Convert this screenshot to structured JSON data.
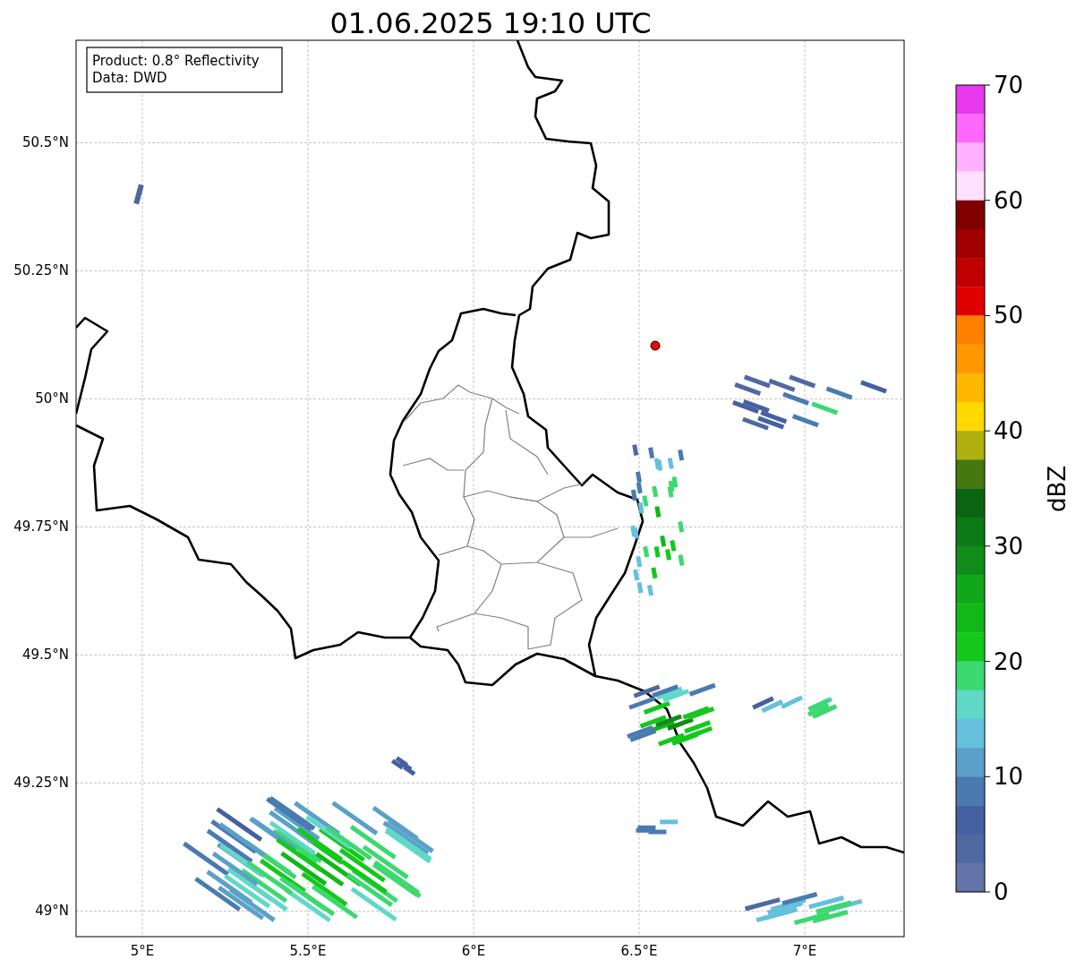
{
  "title": "01.06.2025 19:10 UTC",
  "info_box": [
    "Product: 0.8° Reflectivity",
    "Data: DWD"
  ],
  "map": {
    "lon_ticks": [
      "5°E",
      "5.5°E",
      "6°E",
      "6.5°E",
      "7°E"
    ],
    "lat_ticks": [
      "50.5°N",
      "50.25°N",
      "50°N",
      "49.75°N",
      "49.5°N",
      "49.25°N",
      "49°N"
    ]
  },
  "colorbar": {
    "label": "dBZ",
    "ticks": [
      "70",
      "60",
      "50",
      "40",
      "30",
      "20",
      "10",
      "0"
    ],
    "bins": [
      {
        "color": "#e838f0"
      },
      {
        "color": "#ff68ff"
      },
      {
        "color": "#ffb0ff"
      },
      {
        "color": "#ffe0ff"
      },
      {
        "color": "#800000"
      },
      {
        "color": "#a00000"
      },
      {
        "color": "#c00000"
      },
      {
        "color": "#e00000"
      },
      {
        "color": "#ff8000"
      },
      {
        "color": "#ff9800"
      },
      {
        "color": "#ffb800"
      },
      {
        "color": "#ffd800"
      },
      {
        "color": "#b0b010"
      },
      {
        "color": "#447810"
      },
      {
        "color": "#0a6410"
      },
      {
        "color": "#0c7a14"
      },
      {
        "color": "#108c18"
      },
      {
        "color": "#10a818"
      },
      {
        "color": "#10b818"
      },
      {
        "color": "#14c81c"
      },
      {
        "color": "#3cd870"
      },
      {
        "color": "#60d8c8"
      },
      {
        "color": "#64c0dc"
      },
      {
        "color": "#5aa0c8"
      },
      {
        "color": "#4a7ab0"
      },
      {
        "color": "#4460a0"
      },
      {
        "color": "#5068a0"
      },
      {
        "color": "#6374a8"
      }
    ]
  }
}
